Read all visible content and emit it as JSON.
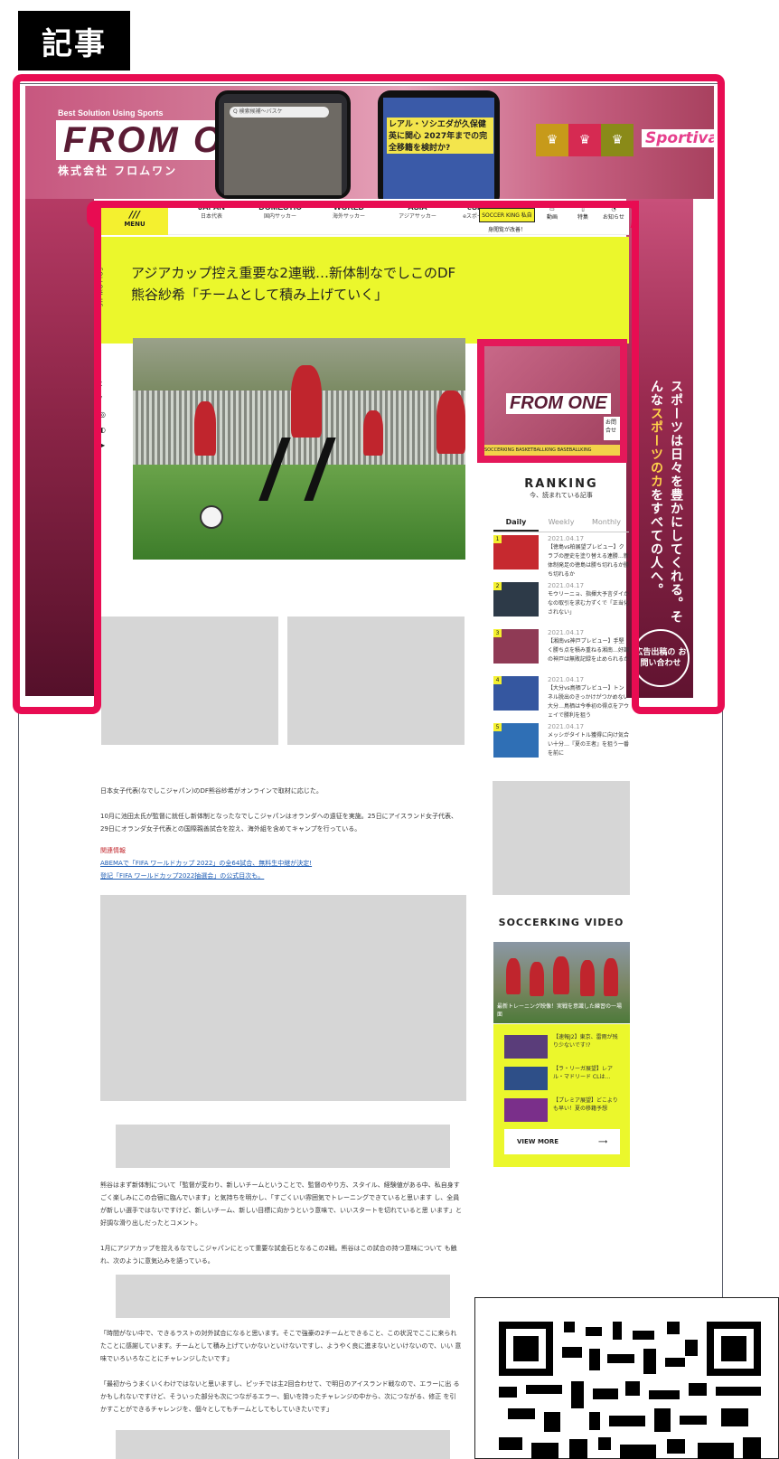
{
  "tag": "記事",
  "banner": {
    "tagline": "Best Solution Using Sports",
    "logo": "FROM ONE",
    "company": "株式会社 フロムワン",
    "phone_search": "Q 検索候補～バスケ",
    "phone_headline": "レアル・ソシエダが久保健英に関心 2027年までの完全移籍を検討か?",
    "partner_buttons": [
      "SOCCERKING",
      "BASKETBALLKING",
      "BASEBALLKING"
    ],
    "sportiva": "Sportiva"
  },
  "side_ad": {
    "vertical_text_pre": "スポーツは日々を豊かにしてくれる。そんな",
    "vertical_text_em": "スポーツのカ",
    "vertical_text_post": "をすべての人へ。",
    "contact": "広告出稿の お問い合わせ"
  },
  "nav": {
    "menu": "MENU",
    "items": [
      {
        "en": "JAPAN",
        "ja": "日本代表"
      },
      {
        "en": "DOMESTIC",
        "ja": "国内サッカー"
      },
      {
        "en": "WORLD",
        "ja": "海外サッカー"
      },
      {
        "en": "ASIA",
        "ja": "アジアサッカー"
      },
      {
        "en": "eSPORTS",
        "ja": "eスポーツサッカー"
      }
    ],
    "yellow_tab": "SOCCER KING 私自身閲覧が改善！",
    "icons": [
      "動画",
      "特集",
      "お知らせ"
    ]
  },
  "article": {
    "title": "アジアカップ控え重要な2連戦…新体制なでしこのDF熊谷紗希「チームとして積み上げていく」",
    "follow_us": "FOLLOW US",
    "social": [
      "t",
      "f",
      "◎",
      "◐",
      "▶"
    ],
    "p1": "日本女子代表(なでしこジャパン)のDF熊谷紗希がオンラインで取材に応じた。",
    "p2": "10月に池田太氏が監督に就任し新体制となったなでしこジャパンはオランダへの遠征を実施。25日にアイスランド女子代表、29日にオランダ女子代表との国際親善試合を控え、海外組を含めてキャンプを行っている。",
    "related_label": "関連情報",
    "related_link1": "ABEMAで「FIFA ワールドカップ 2022」の全64試合、無料生中継が決定!",
    "related_link2": "登記「FIFA ワールドカップ2022抽選会」の公式目次も。",
    "p3": "熊谷はまず新体制について「監督が変わり、新しいチームということで、監督のやり方、スタイル、経験値がある中、私自身すごく楽しみにこの合宿に臨んでいます」と気持ちを明かし、「すごくいい雰囲気でトレーニングできていると思います し、全員が新しい選手ではないですけど、新しいチーム、新しい目標に向かうという意味で、いいスタートを切れていると思 います」と好調な滑り出しだったとコメント。",
    "p4": "1月にアジアカップを控えるなでしこジャパンにとって重要な試金石となるこの2戦。熊谷はこの試合の持つ意味について も触れ、次のように意気込みを語っている。",
    "p5": "「時間がない中で、できるラストの対外試合になると思います。そこで強豪の2チームとできること、この状況でここに来られ たことに感謝しています。チームとして積み上げていかないといけないですし、ようやく良に進まないといけないので、いい 意味でいろいろなことにチャレンジしたいです」",
    "p6": "「最初からうまくいくわけではないと思いますし、ピッチでは主2回合わせて、で明日のアイスランド戦なので、エラーに出 るかもしれないですけど、そういった部分も次につながるエラー、狙いを持ったチャレンジの中から、次につながる、修正 を引かすことができるチャレンジを、個々としてもチームとしてもしていきたいです」"
  },
  "sidebar_ad": {
    "logo": "FROM ONE",
    "side_text": "お問 合せ",
    "partners": "SOCCERKING BASKETBALLKING BASEBALLKING"
  },
  "ranking": {
    "title": "RANKING",
    "subtitle": "今、読まれている記事",
    "tabs": [
      "Daily",
      "Weekly",
      "Monthly"
    ],
    "items": [
      {
        "num": "1",
        "date": "2021.04.17",
        "text": "【徳島vs柏展望プレビュー】クラブの歴史を塗り替える連勝…新体制発足の徳島は勝ち切れるか勝ち切れるか",
        "color": "#c6292f"
      },
      {
        "num": "2",
        "date": "2021.04.17",
        "text": "モウリーニョ、指揮大予言ダイかなの取引を求む力ずくで「正当化されない」",
        "color": "#2d3a48"
      },
      {
        "num": "3",
        "date": "2021.04.17",
        "text": "【湘南vs神戸プレビュー】手堅く勝ち点を積み重ねる湘南…好調の神戸は無敗記録を止められるか",
        "color": "#8f3a55"
      },
      {
        "num": "4",
        "date": "2021.04.17",
        "text": "【大分vs鳥栖プレビュー】トンネル脱出のきっかけがつかめない大分…鳥栖は今季初の得点をアウェイで勝利を狙う",
        "color": "#3557a0"
      },
      {
        "num": "5",
        "date": "2021.04.17",
        "text": "メッシがタイトル獲得に向け気合い十分…『夏の王者』を狙う一番を前に",
        "color": "#2f6fb5"
      }
    ]
  },
  "video": {
    "title": "SOCCERKING VIDEO",
    "caption": "最新トレーニング映像！実戦を意識した練習の一場面",
    "items": [
      {
        "text": "【速報J2】東京、雷雨が残り少ないです!?",
        "color": "#5a3d7a"
      },
      {
        "text": "【ラ・リーガ展望】レアル・マドリード CLは…",
        "color": "#2e4f88"
      },
      {
        "text": "【プレミア展望】どこよりも早い！夏の移籍予想",
        "color": "#7a2f8a"
      }
    ],
    "view_more": "VIEW MORE",
    "arrow": "⟶"
  }
}
